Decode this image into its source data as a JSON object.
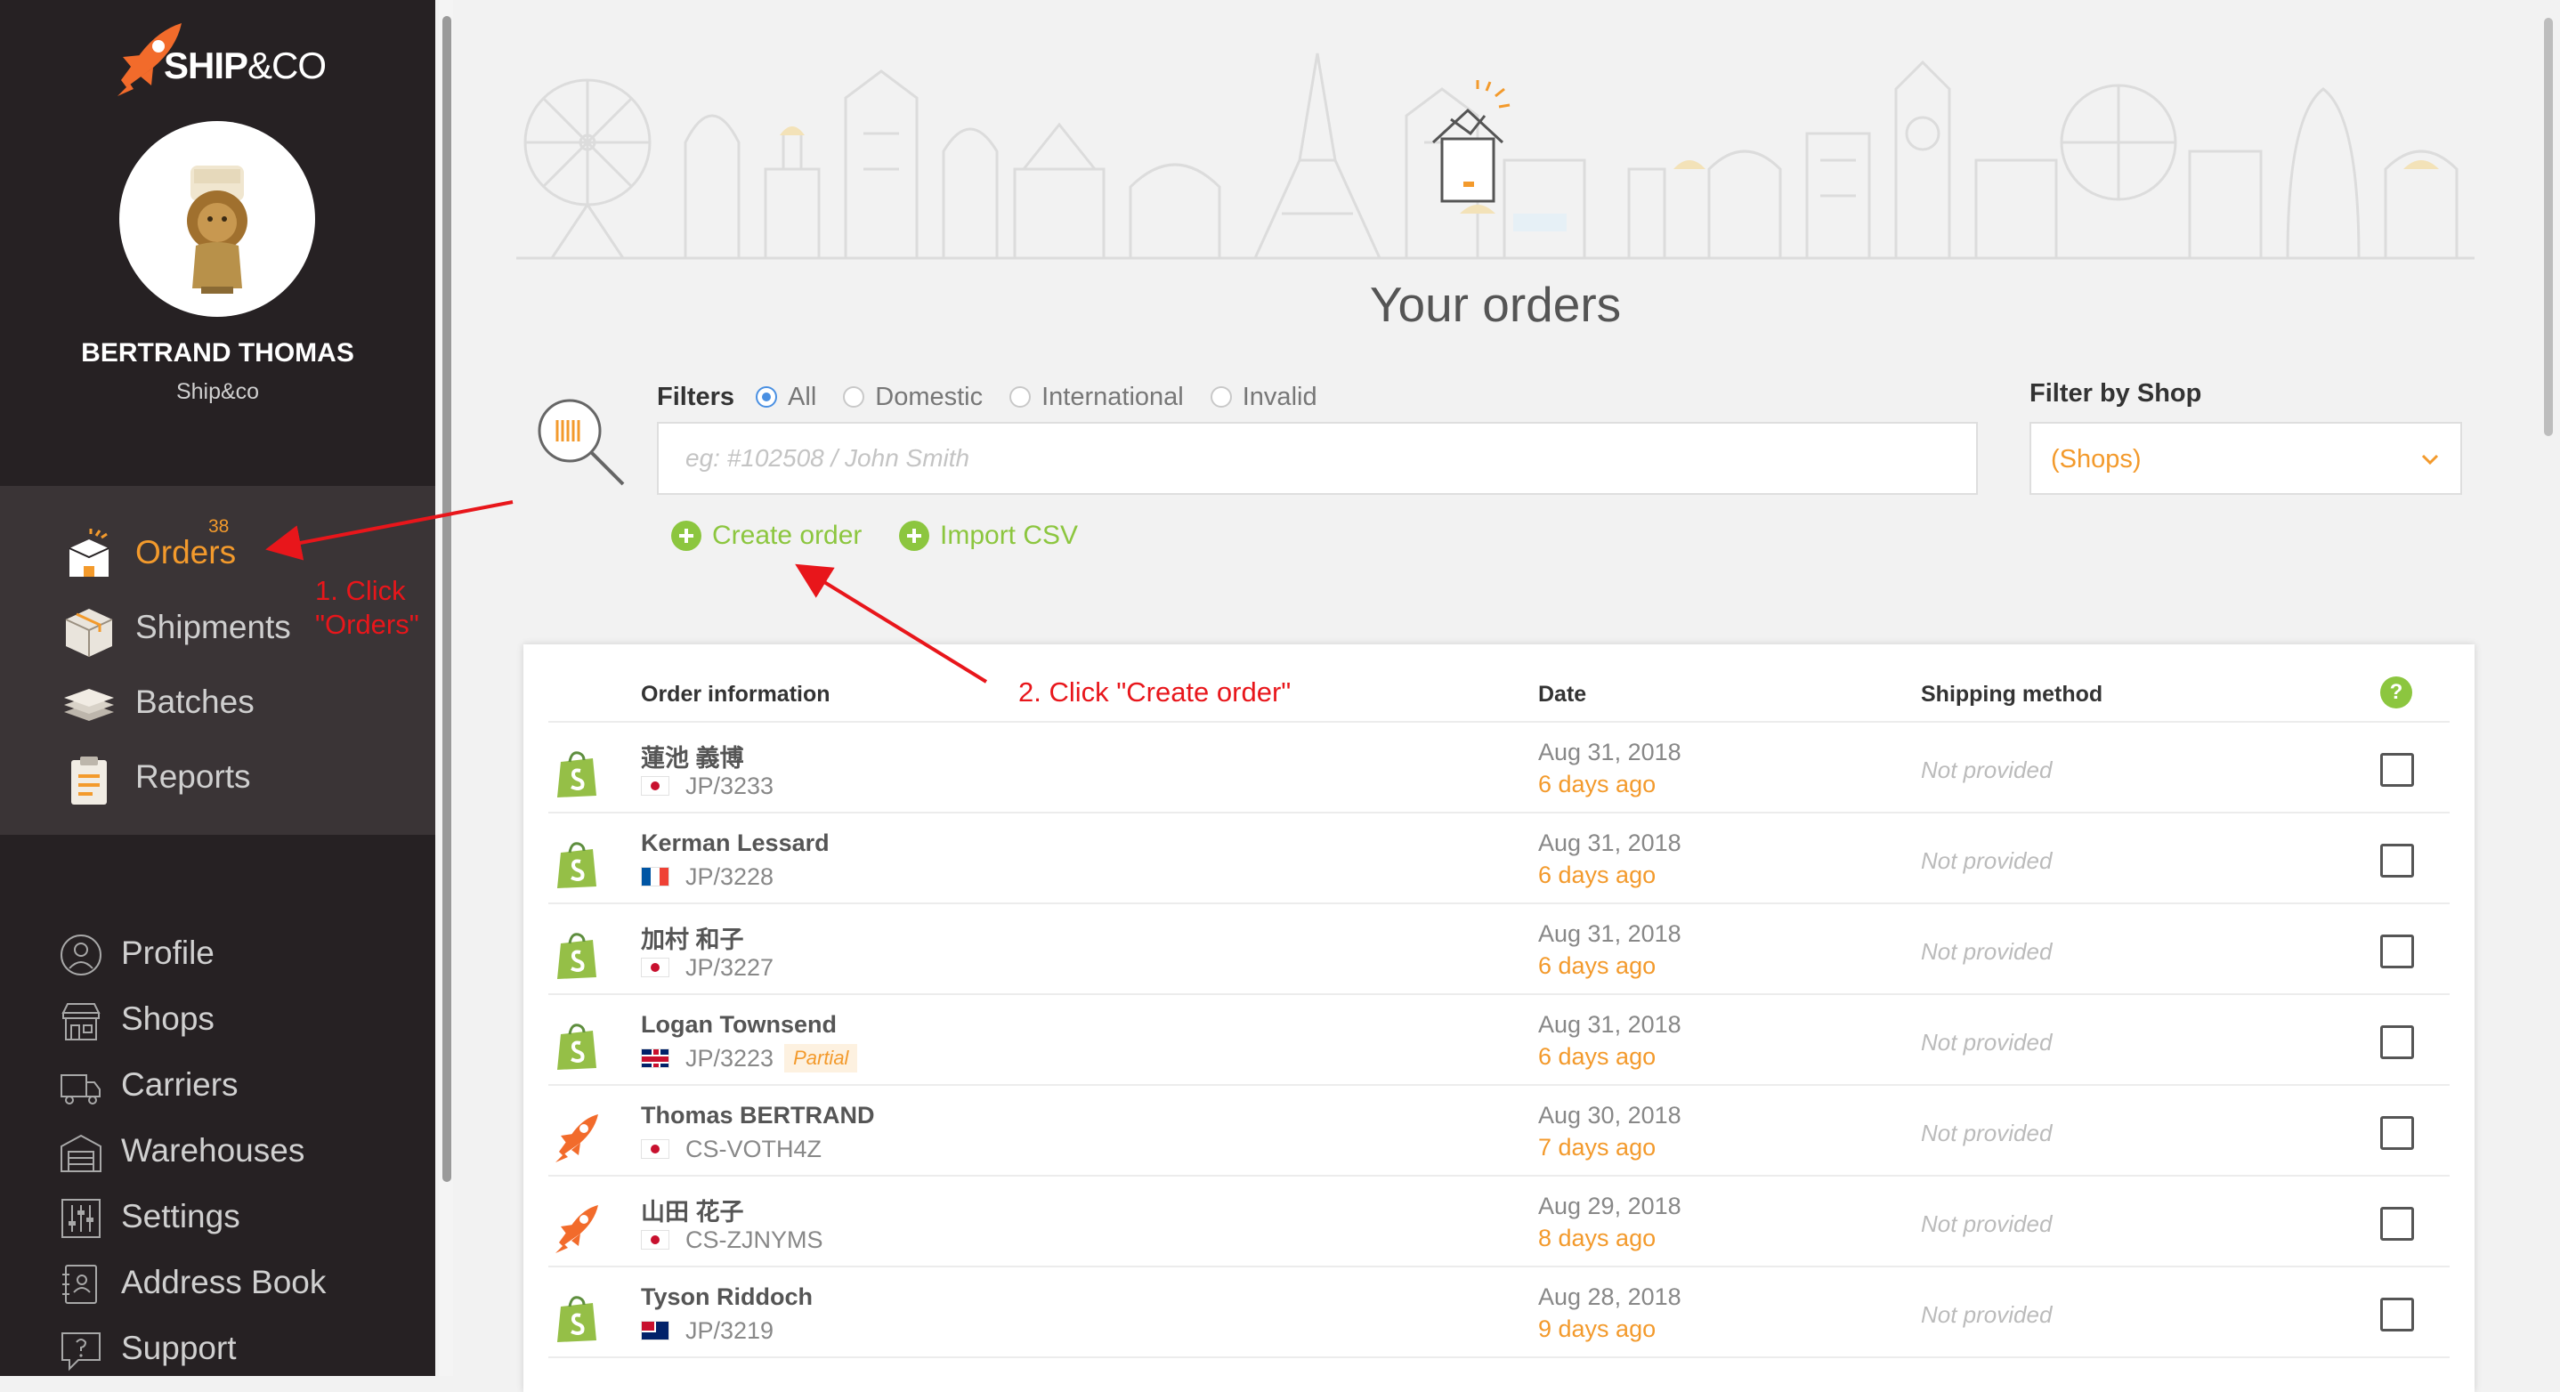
{
  "brand": {
    "logo_main": "SHIP",
    "logo_amp": "&CO"
  },
  "user": {
    "name": "BERTRAND THOMAS",
    "company": "Ship&co"
  },
  "primary_nav": [
    {
      "label": "Orders",
      "badge": "38",
      "active": true,
      "icon": "orders-box-icon"
    },
    {
      "label": "Shipments",
      "icon": "shipments-package-icon"
    },
    {
      "label": "Batches",
      "icon": "batches-stack-icon"
    },
    {
      "label": "Reports",
      "icon": "reports-clipboard-icon"
    }
  ],
  "secondary_nav": [
    {
      "label": "Profile",
      "icon": "profile-user-icon"
    },
    {
      "label": "Shops",
      "icon": "shops-store-icon"
    },
    {
      "label": "Carriers",
      "icon": "carriers-truck-icon"
    },
    {
      "label": "Warehouses",
      "icon": "warehouses-building-icon"
    },
    {
      "label": "Settings",
      "icon": "settings-sliders-icon"
    },
    {
      "label": "Address Book",
      "icon": "address-book-icon"
    },
    {
      "label": "Support",
      "icon": "support-question-icon"
    }
  ],
  "annotations": {
    "step1_line1": "1. Click",
    "step1_line2": "\"Orders\"",
    "step2": "2. Click \"Create order\""
  },
  "page": {
    "title": "Your orders"
  },
  "filters": {
    "label": "Filters",
    "options": [
      "All",
      "Domestic",
      "International",
      "Invalid"
    ],
    "selected": "All",
    "search_placeholder": "eg: #102508 / John Smith",
    "search_value": ""
  },
  "shop_filter": {
    "label": "Filter by Shop",
    "selected": "(Shops)"
  },
  "actions": {
    "create_order": "Create order",
    "import_csv": "Import CSV"
  },
  "table": {
    "headers": {
      "info": "Order information",
      "date": "Date",
      "shipping": "Shipping method",
      "help": "?"
    },
    "rows": [
      {
        "source": "shopify",
        "name": "蓮池 義博",
        "flag": "jp",
        "id": "JP/3233",
        "tag": "",
        "date": "Aug 31, 2018",
        "ago": "6 days ago",
        "shipping": "Not provided"
      },
      {
        "source": "shopify",
        "name": "Kerman Lessard",
        "flag": "fr",
        "id": "JP/3228",
        "tag": "",
        "date": "Aug 31, 2018",
        "ago": "6 days ago",
        "shipping": "Not provided"
      },
      {
        "source": "shopify",
        "name": "加村 和子",
        "flag": "jp",
        "id": "JP/3227",
        "tag": "",
        "date": "Aug 31, 2018",
        "ago": "6 days ago",
        "shipping": "Not provided"
      },
      {
        "source": "shopify",
        "name": "Logan Townsend",
        "flag": "gb",
        "id": "JP/3223",
        "tag": "Partial",
        "date": "Aug 31, 2018",
        "ago": "6 days ago",
        "shipping": "Not provided"
      },
      {
        "source": "shipandco",
        "name": "Thomas BERTRAND",
        "flag": "jp",
        "id": "CS-VOTH4Z",
        "tag": "",
        "date": "Aug 30, 2018",
        "ago": "7 days ago",
        "shipping": "Not provided"
      },
      {
        "source": "shipandco",
        "name": "山田 花子",
        "flag": "jp",
        "id": "CS-ZJNYMS",
        "tag": "",
        "date": "Aug 29, 2018",
        "ago": "8 days ago",
        "shipping": "Not provided"
      },
      {
        "source": "shopify",
        "name": "Tyson Riddoch",
        "flag": "au",
        "id": "JP/3219",
        "tag": "",
        "date": "Aug 28, 2018",
        "ago": "9 days ago",
        "shipping": "Not provided"
      }
    ]
  },
  "colors": {
    "accent": "#f39a2c",
    "green": "#8cc63f",
    "sidebar": "#262123",
    "annotation": "#e8161b",
    "radio": "#4a90e2"
  }
}
